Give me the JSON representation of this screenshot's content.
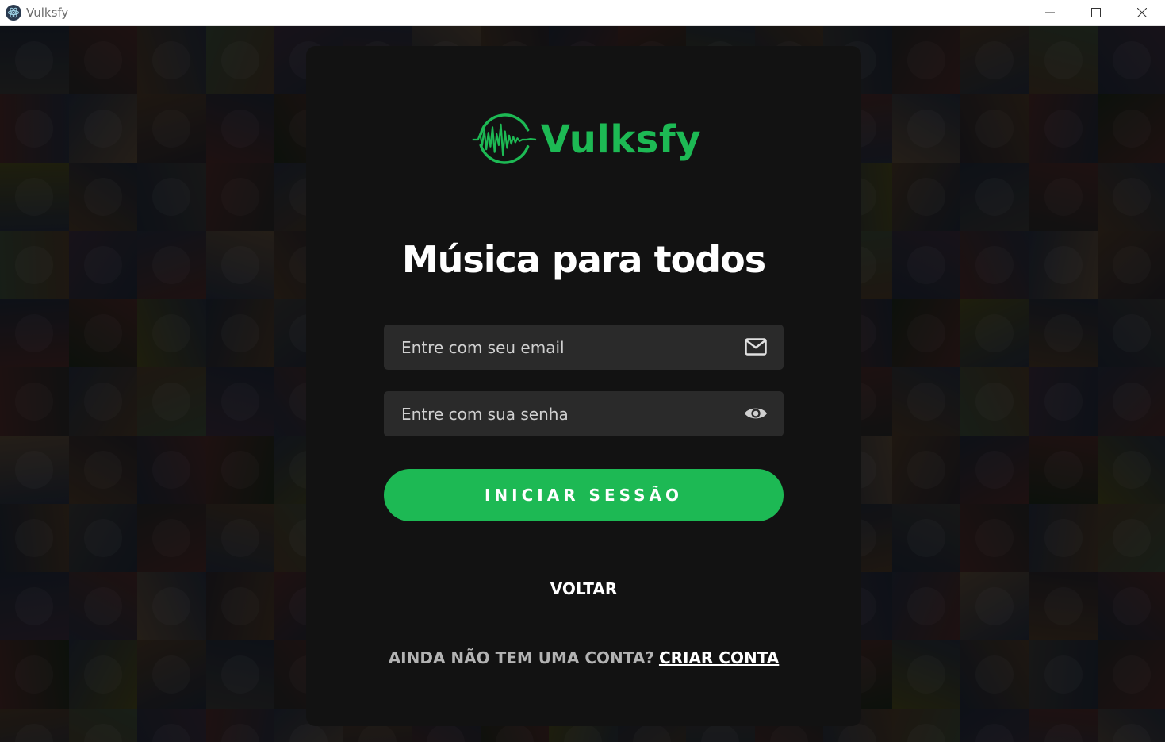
{
  "window": {
    "title": "Vulksfy",
    "app_icon": "electron-icon",
    "controls": [
      "minimize-icon",
      "maximize-icon",
      "close-icon"
    ]
  },
  "background": {
    "description_colors": [
      "#3a3a3a",
      "#2b2730",
      "#4a3a2a",
      "#1f2a1f",
      "#3b2f3f",
      "#222a3a",
      "#5a4a3a",
      "#2a2a2a",
      "#4a2a2a",
      "#3a4a3a",
      "#4a4a20",
      "#283040"
    ]
  },
  "logo": {
    "text": "Vulksfy",
    "icon": "soundwave-circle-icon",
    "color": "#1db954"
  },
  "headline": "Música para todos",
  "email": {
    "placeholder": "Entre com seu email",
    "value": "",
    "icon": "envelope-icon"
  },
  "password": {
    "placeholder": "Entre com sua senha",
    "value": "",
    "icon": "eye-icon"
  },
  "login_button": "INICIAR SESSÃO",
  "back_link": "VOLTAR",
  "signup": {
    "prompt": "AINDA NÃO TEM UMA CONTA?",
    "link": "CRIAR CONTA"
  },
  "colors": {
    "accent": "#1db954",
    "card": "#121212",
    "field": "#2a2a2a"
  }
}
